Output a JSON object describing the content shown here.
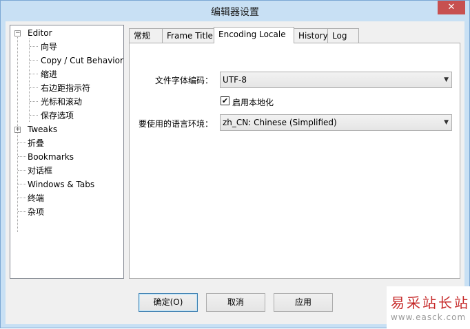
{
  "window": {
    "title": "编辑器设置",
    "close_glyph": "✕"
  },
  "tree": {
    "items": [
      {
        "label": "Editor",
        "level": 0,
        "expander": "−"
      },
      {
        "label": "向导",
        "level": 1
      },
      {
        "label": "Copy / Cut Behavior",
        "level": 1
      },
      {
        "label": "缩进",
        "level": 1
      },
      {
        "label": "右边距指示符",
        "level": 1
      },
      {
        "label": "光标和滚动",
        "level": 1
      },
      {
        "label": "保存选项",
        "level": 1
      },
      {
        "label": "Tweaks",
        "level": 0,
        "expander": "+"
      },
      {
        "label": "折叠",
        "level": 0
      },
      {
        "label": "Bookmarks",
        "level": 0
      },
      {
        "label": "对话框",
        "level": 0
      },
      {
        "label": "Windows & Tabs",
        "level": 0
      },
      {
        "label": "终端",
        "level": 0
      },
      {
        "label": "杂项",
        "level": 0,
        "selected": true
      }
    ]
  },
  "tabs": [
    {
      "label": "常规"
    },
    {
      "label": "Frame Title"
    },
    {
      "label": "Encoding  Locale",
      "active": true
    },
    {
      "label": "History"
    },
    {
      "label": "Log"
    }
  ],
  "locale_panel": {
    "encoding_label": "文件字体编码：",
    "encoding_value": "UTF-8",
    "enable_localization_label": "启用本地化",
    "enable_localization_checked": true,
    "check_glyph": "✔",
    "language_label": "要使用的语言环境：",
    "language_value": "zh_CN: Chinese (Simplified)",
    "dropdown_glyph": "▼"
  },
  "buttons": {
    "ok": "确定(O)",
    "cancel": "取消",
    "apply": "应用"
  },
  "watermark": {
    "line1": "易采站长站",
    "line2": "www.easck.com"
  }
}
